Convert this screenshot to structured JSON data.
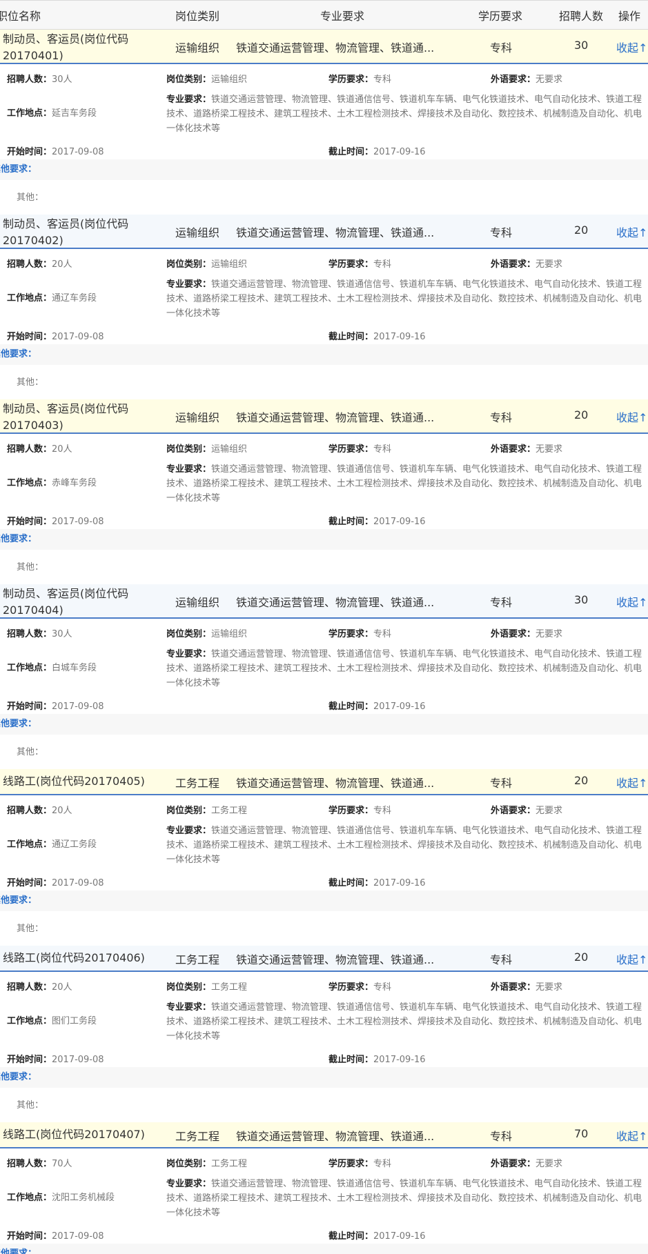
{
  "header": {
    "name": "职位名称",
    "category": "岗位类别",
    "major": "专业要求",
    "education": "学历要求",
    "count": "招聘人数",
    "operation": "操作"
  },
  "labels": {
    "count": "招聘人数：",
    "category": "岗位类别：",
    "education": "学历要求：",
    "language": "外语要求：",
    "major": "专业要求：",
    "location": "工作地点：",
    "start": "开始时间：",
    "end": "截止时间：",
    "other_req": "其他要求：",
    "other": "其他："
  },
  "jobs": [
    {
      "name": "制动员、客运员(岗位代码20170401)",
      "category": "运输组织",
      "major_short": "铁道交通运营管理、物流管理、铁道通...",
      "education": "专科",
      "count": "30",
      "toggle": "收起↑",
      "count_full": "30人",
      "language": "无要求",
      "major_full": "铁道交通运营管理、物流管理、铁道通信信号、铁道机车车辆、电气化铁道技术、电气自动化技术、铁道工程技术、道路桥梁工程技术、建筑工程技术、土木工程检测技术、焊接技术及自动化、数控技术、机械制造及自动化、机电一体化技术等",
      "location": "延吉车务段",
      "start": "2017-09-08",
      "end": "2017-09-16"
    },
    {
      "name": "制动员、客运员(岗位代码20170402)",
      "category": "运输组织",
      "major_short": "铁道交通运营管理、物流管理、铁道通...",
      "education": "专科",
      "count": "20",
      "toggle": "收起↑",
      "count_full": "20人",
      "language": "无要求",
      "major_full": "铁道交通运营管理、物流管理、铁道通信信号、铁道机车车辆、电气化铁道技术、电气自动化技术、铁道工程技术、道路桥梁工程技术、建筑工程技术、土木工程检测技术、焊接技术及自动化、数控技术、机械制造及自动化、机电一体化技术等",
      "location": "通辽车务段",
      "start": "2017-09-08",
      "end": "2017-09-16"
    },
    {
      "name": "制动员、客运员(岗位代码20170403)",
      "category": "运输组织",
      "major_short": "铁道交通运营管理、物流管理、铁道通...",
      "education": "专科",
      "count": "20",
      "toggle": "收起↑",
      "count_full": "20人",
      "language": "无要求",
      "major_full": "铁道交通运营管理、物流管理、铁道通信信号、铁道机车车辆、电气化铁道技术、电气自动化技术、铁道工程技术、道路桥梁工程技术、建筑工程技术、土木工程检测技术、焊接技术及自动化、数控技术、机械制造及自动化、机电一体化技术等",
      "location": "赤峰车务段",
      "start": "2017-09-08",
      "end": "2017-09-16"
    },
    {
      "name": "制动员、客运员(岗位代码20170404)",
      "category": "运输组织",
      "major_short": "铁道交通运营管理、物流管理、铁道通...",
      "education": "专科",
      "count": "30",
      "toggle": "收起↑",
      "count_full": "30人",
      "language": "无要求",
      "major_full": "铁道交通运营管理、物流管理、铁道通信信号、铁道机车车辆、电气化铁道技术、电气自动化技术、铁道工程技术、道路桥梁工程技术、建筑工程技术、土木工程检测技术、焊接技术及自动化、数控技术、机械制造及自动化、机电一体化技术等",
      "location": "白城车务段",
      "start": "2017-09-08",
      "end": "2017-09-16"
    },
    {
      "name": "线路工(岗位代码20170405)",
      "category": "工务工程",
      "major_short": "铁道交通运营管理、物流管理、铁道通...",
      "education": "专科",
      "count": "20",
      "toggle": "收起↑",
      "count_full": "20人",
      "language": "无要求",
      "major_full": "铁道交通运营管理、物流管理、铁道通信信号、铁道机车车辆、电气化铁道技术、电气自动化技术、铁道工程技术、道路桥梁工程技术、建筑工程技术、土木工程检测技术、焊接技术及自动化、数控技术、机械制造及自动化、机电一体化技术等",
      "location": "通辽工务段",
      "start": "2017-09-08",
      "end": "2017-09-16"
    },
    {
      "name": "线路工(岗位代码20170406)",
      "category": "工务工程",
      "major_short": "铁道交通运营管理、物流管理、铁道通...",
      "education": "专科",
      "count": "20",
      "toggle": "收起↑",
      "count_full": "20人",
      "language": "无要求",
      "major_full": "铁道交通运营管理、物流管理、铁道通信信号、铁道机车车辆、电气化铁道技术、电气自动化技术、铁道工程技术、道路桥梁工程技术、建筑工程技术、土木工程检测技术、焊接技术及自动化、数控技术、机械制造及自动化、机电一体化技术等",
      "location": "图们工务段",
      "start": "2017-09-08",
      "end": "2017-09-16"
    },
    {
      "name": "线路工(岗位代码20170407)",
      "category": "工务工程",
      "major_short": "铁道交通运营管理、物流管理、铁道通...",
      "education": "专科",
      "count": "70",
      "toggle": "收起↑",
      "count_full": "70人",
      "language": "无要求",
      "major_full": "铁道交通运营管理、物流管理、铁道通信信号、铁道机车车辆、电气化铁道技术、电气自动化技术、铁道工程技术、道路桥梁工程技术、建筑工程技术、土木工程检测技术、焊接技术及自动化、数控技术、机械制造及自动化、机电一体化技术等",
      "location": "沈阳工务机械段",
      "start": "2017-09-08",
      "end": "2017-09-16"
    }
  ]
}
